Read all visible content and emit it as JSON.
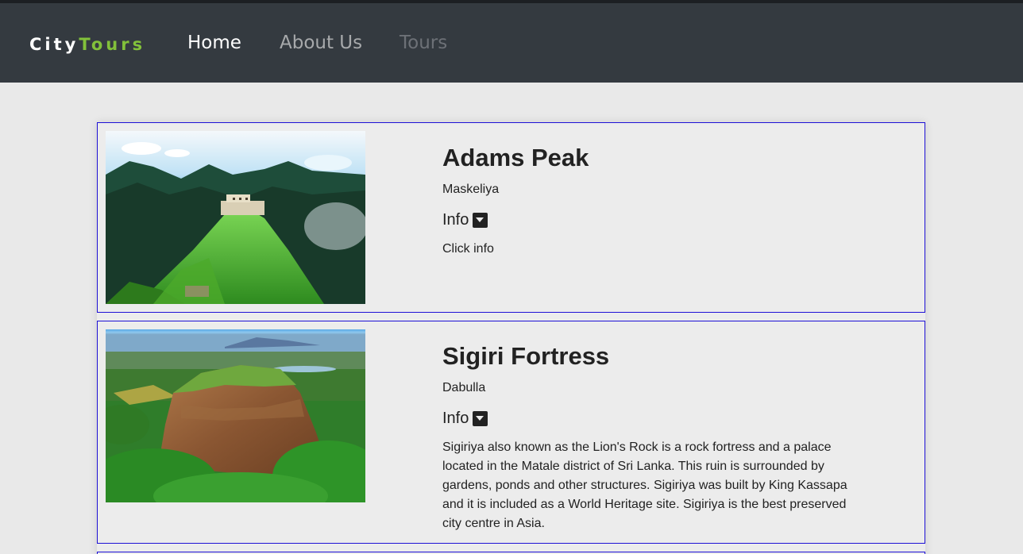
{
  "navbar": {
    "brand_part1": "City",
    "brand_part2": "Tours",
    "links": [
      {
        "label": "Home"
      },
      {
        "label": "About Us"
      },
      {
        "label": "Tours"
      }
    ]
  },
  "tours": [
    {
      "title": "Adams Peak",
      "location": "Maskeliya",
      "info_label": "Info",
      "description": "Click info"
    },
    {
      "title": "Sigiri Fortress",
      "location": "Dabulla",
      "info_label": "Info",
      "description": "Sigiriya also known as the Lion's Rock is a rock fortress and a palace located in the Matale district of Sri Lanka. This ruin is surrounded by gardens, ponds and other structures. Sigiriya was built by King Kassapa and it is included as a World Heritage site. Sigiriya is the best preserved city centre in Asia."
    }
  ],
  "colors": {
    "navbar_bg": "#343a40",
    "brand_accent": "#82c13a",
    "card_border": "#1d10d6",
    "page_bg": "#e9e9e9"
  },
  "icons": {
    "info_toggle": "caret-down-square-icon"
  }
}
